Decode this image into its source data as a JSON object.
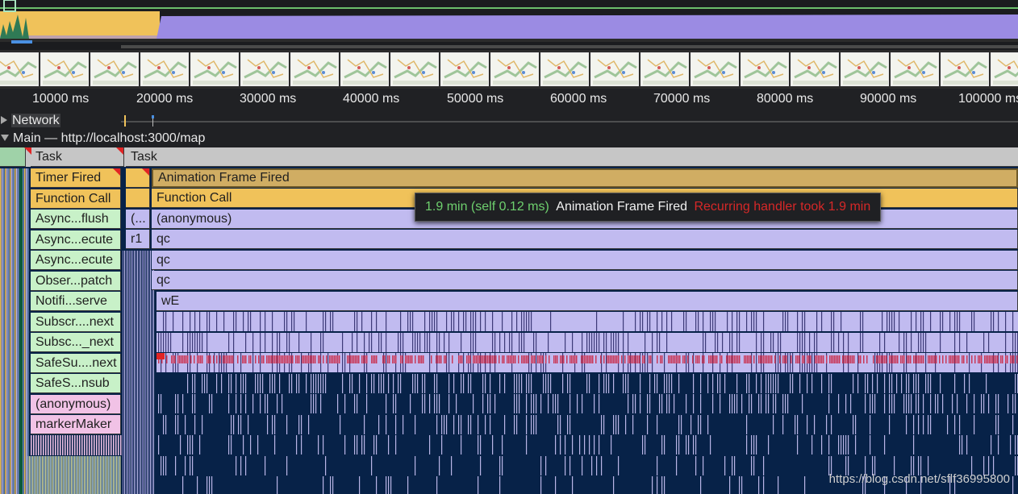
{
  "overview": {
    "label": "timeline-overview"
  },
  "ruler": {
    "ticks": [
      "10000 ms",
      "20000 ms",
      "30000 ms",
      "40000 ms",
      "50000 ms",
      "60000 ms",
      "70000 ms",
      "80000 ms",
      "90000 ms",
      "100000 ms"
    ]
  },
  "tracks": {
    "network": "Network",
    "main": "Main — http://localhost:3000/map"
  },
  "flame_left": {
    "task": "Task",
    "rows": [
      "Timer Fired",
      "Function Call",
      "Async...flush",
      "Async...ecute",
      "Async...ecute",
      "Obser...patch",
      "Notifi...serve",
      "Subscr....next",
      "Subsc..._next",
      "SafeSu....next",
      "SafeS...nsub",
      "(anonymous)",
      "markerMaker"
    ]
  },
  "flame_mid": {
    "task": "Task",
    "row3": "(...",
    "row4": "r1"
  },
  "flame_main": {
    "rows": [
      "Animation Frame Fired",
      "Function Call",
      "(anonymous)",
      "qc",
      "qc",
      "qc",
      "wE"
    ]
  },
  "tooltip": {
    "duration": "1.9 min (self 0.12 ms)",
    "event": "Animation Frame Fired",
    "warning": "Recurring handler took 1.9 min"
  },
  "watermark": "https://blog.csdn.net/sflf36995800",
  "colors": {
    "task": "#c6c6c6",
    "timer": "#f0c25a",
    "animation": "#d0ad63",
    "script_purple": "#c1bbf0",
    "green": "#c8f1c8",
    "pink": "#f1c2e6",
    "dense_blue": "#072248",
    "tooltip_green": "#6ed06e",
    "tooltip_red": "#d62828"
  }
}
